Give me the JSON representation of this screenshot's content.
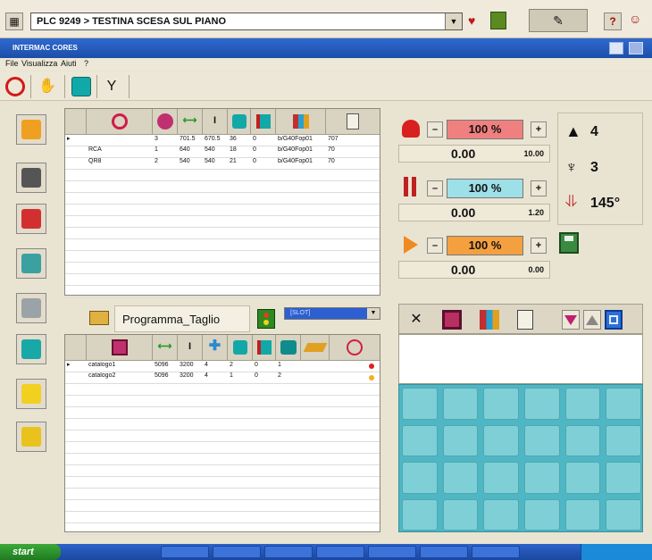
{
  "window": {
    "title": "INTERMAC CORES",
    "menu": [
      "File",
      "Visualizza",
      "Aiuti",
      "?"
    ]
  },
  "topbar": {
    "program_path": "PLC 9249 > TESTINA SCESA SUL PIANO",
    "icons": [
      "app-grid-icon",
      "dropdown-arrow-icon",
      "heart-shield-icon",
      "green-square-icon",
      "pen-icon",
      "help-icon",
      "people-icon"
    ]
  },
  "toolbar": {
    "icons": [
      "stop-icon",
      "hand-icon",
      "teal-block-icon",
      "tool-icon"
    ]
  },
  "top_table": {
    "header_icons": [
      "red-shape-icon",
      "magenta-shape-icon",
      "width-icon",
      "height-icon",
      "teal-block-icon",
      "split-icon",
      "pattern-icon",
      "document-icon"
    ],
    "rows": [
      {
        "marker": "▸",
        "name": "",
        "c1": "3",
        "c2": "701.5",
        "c3": "670.5",
        "c4": "36",
        "c5": "0",
        "c6": "b/G40Fop01",
        "c7": "707"
      },
      {
        "marker": "",
        "name": "RCA",
        "c1": "1",
        "c2": "640",
        "c3": "540",
        "c4": "18",
        "c5": "0",
        "c6": "b/G40Fop01",
        "c7": "70"
      },
      {
        "marker": "",
        "name": "QR8",
        "c1": "2",
        "c2": "540",
        "c3": "540",
        "c4": "21",
        "c5": "0",
        "c6": "b/G40Fop01",
        "c7": "70"
      }
    ],
    "empty_rows": 11
  },
  "program": {
    "name": "Programma_Taglio",
    "dropdown_value": "[SLOT]"
  },
  "bottom_table": {
    "header_icons": [
      "pattern-icon",
      "width-icon",
      "height-icon",
      "cross-icon",
      "teal-block-icon",
      "split-icon",
      "teal-block-icon",
      "plank-icon",
      "clock-icon"
    ],
    "rows": [
      {
        "marker": "▸",
        "name": "catalogo1",
        "c1": "5096",
        "c2": "3200",
        "c3": "4",
        "c4": "2",
        "c5": "0",
        "c6": "1",
        "dot": "#e02020"
      },
      {
        "marker": "",
        "name": "catalogo2",
        "c1": "5096",
        "c2": "3200",
        "c3": "4",
        "c4": "1",
        "c5": "0",
        "c6": "2",
        "dot": "#f0b020"
      }
    ],
    "empty_rows": 14
  },
  "overrides": [
    {
      "icon": "red-axis-icon",
      "percent": "100 %",
      "value": "0.00",
      "max": "10.00",
      "color": "#f08080"
    },
    {
      "icon": "red-spindle-icon",
      "percent": "100 %",
      "value": "0.00",
      "max": "1.20",
      "color": "#9ee0e8"
    },
    {
      "icon": "orange-arrow-icon",
      "percent": "100 %",
      "value": "0.00",
      "max": "0.00",
      "color": "#f5a040"
    }
  ],
  "overrides_fill": [
    1.0,
    1.0,
    1.0
  ],
  "status": [
    {
      "icon": "up-arrow-icon",
      "value": "4"
    },
    {
      "icon": "tool-holder-icon",
      "value": "3"
    },
    {
      "icon": "angle-icon",
      "value": "145°"
    }
  ],
  "right_toolbar_icons": [
    "knife-icon",
    "red-square-icon",
    "pattern-icon",
    "document-icon",
    "triangle-down-icon",
    "triangle-up-icon",
    "window-icon"
  ],
  "side_buttons": [
    "layout-icon",
    "clamp-icon",
    "measure-icon",
    "drill-icon",
    "cad-icon",
    "lock-icon",
    "teal-table-icon",
    "yellow-gauge-icon",
    "yellow-marker-icon"
  ],
  "colors": {
    "title_blue": "#2f6ad0",
    "panel_bg": "#e9e4d2",
    "sheet_teal": "#7fd0d6",
    "dropdown_blue": "#2d5fd0"
  },
  "taskbar": {
    "start_label": "start"
  }
}
